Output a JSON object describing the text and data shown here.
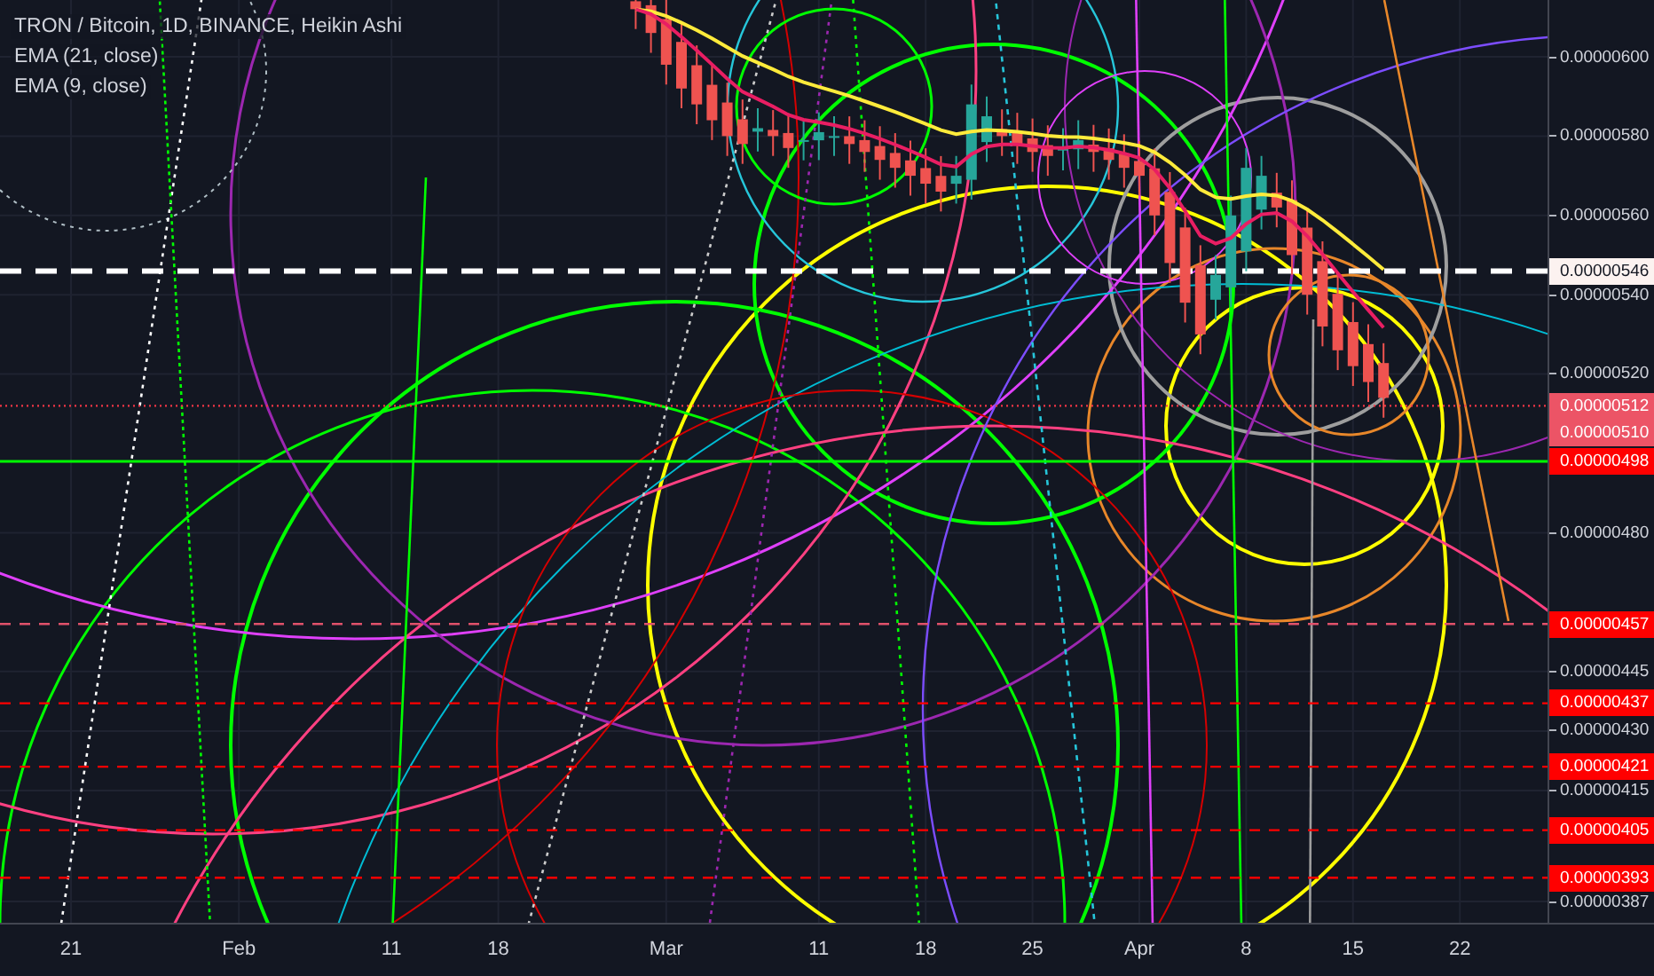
{
  "legend": {
    "title": "TRON / Bitcoin, 1D, BINANCE, Heikin Ashi",
    "indicators": [
      "EMA (21, close)",
      "EMA (9, close)"
    ]
  },
  "price_axis": {
    "ticks": [
      "0.00000600",
      "0.00000580",
      "0.00000560",
      "0.00000540",
      "0.00000520",
      "0.00000480",
      "0.00000445",
      "0.00000430",
      "0.00000415",
      "0.00000387"
    ],
    "markers": [
      {
        "label": "0.00000546",
        "color": "#fcf2f0",
        "line": {
          "kind": "dashed",
          "color": "#ffffff"
        }
      },
      {
        "label": "0.00000512",
        "color": "#ec5466",
        "line": {
          "kind": "dotted",
          "color": "#f23645"
        }
      },
      {
        "label": "0.00000510",
        "color": "#ec5466"
      },
      {
        "label": "0.00000498",
        "color": "#ff0000",
        "line": {
          "kind": "solid",
          "color": "#00ff00"
        }
      },
      {
        "label": "0.00000457",
        "color": "#ff0000",
        "line": {
          "kind": "dashed",
          "color": "#e0516a"
        }
      },
      {
        "label": "0.00000437",
        "color": "#ff0000",
        "line": {
          "kind": "dashed",
          "color": "#ff0000"
        }
      },
      {
        "label": "0.00000421",
        "color": "#ff0000",
        "line": {
          "kind": "dashed",
          "color": "#ff0000"
        }
      },
      {
        "label": "0.00000405",
        "color": "#ff0000",
        "line": {
          "kind": "dashed",
          "color": "#ff0000"
        }
      },
      {
        "label": "0.00000393",
        "color": "#ff0000",
        "line": {
          "kind": "dashed",
          "color": "#ff0000"
        }
      }
    ]
  },
  "time_axis": {
    "labels": [
      "21",
      "Feb",
      "11",
      "18",
      "Mar",
      "11",
      "18",
      "25",
      "Apr",
      "8",
      "15",
      "22"
    ]
  }
}
